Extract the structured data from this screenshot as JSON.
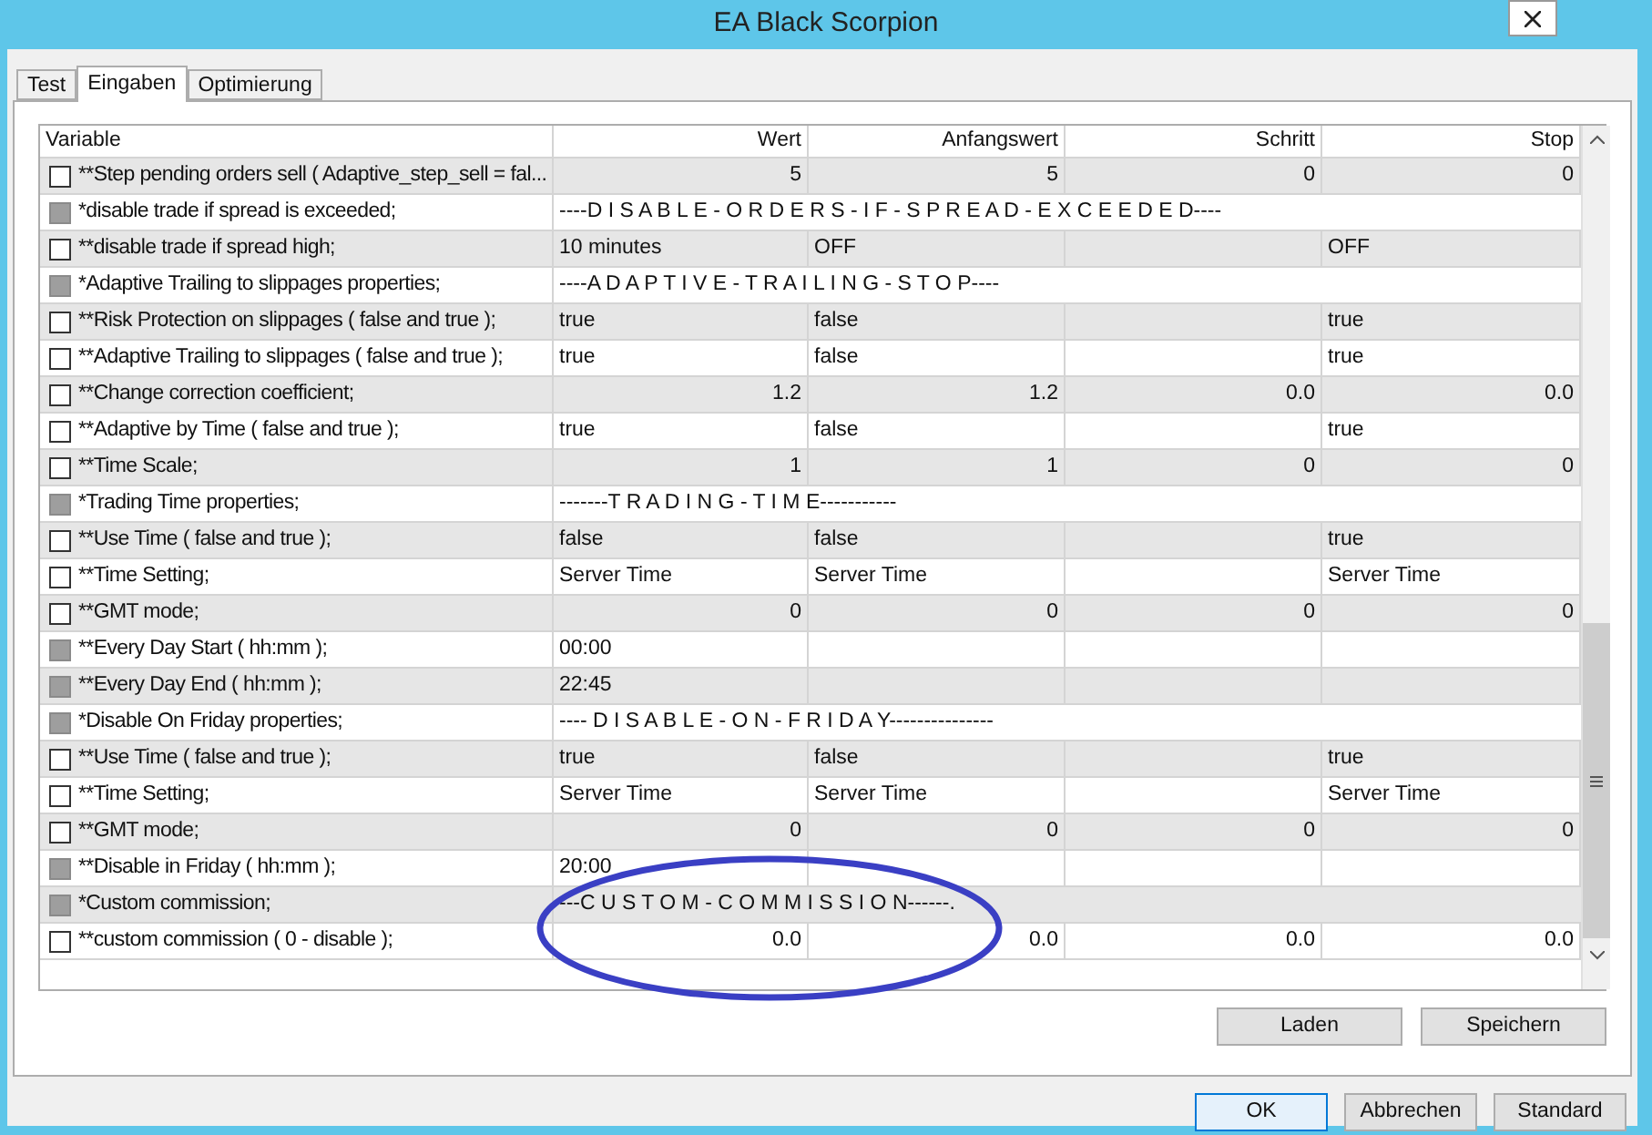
{
  "window": {
    "title": "EA Black Scorpion"
  },
  "tabs": [
    {
      "label": "Test",
      "selected": false
    },
    {
      "label": "Eingaben",
      "selected": true
    },
    {
      "label": "Optimierung",
      "selected": false
    }
  ],
  "table": {
    "columns": [
      "Variable",
      "Wert",
      "Anfangswert",
      "Schritt",
      "Stop"
    ],
    "rows": [
      {
        "kind": "param",
        "label": "**Step pending orders sell ( Adaptive_step_sell = fal...",
        "disabled": false,
        "value": "5",
        "start": "5",
        "step": "0",
        "stop": "0",
        "numeric": true
      },
      {
        "kind": "section",
        "label": "*disable trade if spread is exceeded;",
        "disabled": true,
        "value": "----D I S A B L E - O R D E R S - I F - S P R E A D - E X C E E D E D----"
      },
      {
        "kind": "param",
        "label": "**disable trade if spread high;",
        "disabled": false,
        "value": "10 minutes",
        "start": "OFF",
        "stop": "OFF",
        "numeric": false
      },
      {
        "kind": "section",
        "label": "*Adaptive Trailing to slippages properties;",
        "disabled": true,
        "value": "----A D A P T I V E - T R A I L I N G - S T O P----"
      },
      {
        "kind": "param",
        "label": "**Risk Protection on slippages ( false and true );",
        "disabled": false,
        "value": "true",
        "start": "false",
        "stop": "true",
        "numeric": false
      },
      {
        "kind": "param",
        "label": "**Adaptive Trailing to slippages ( false and true );",
        "disabled": false,
        "value": "true",
        "start": "false",
        "stop": "true",
        "numeric": false
      },
      {
        "kind": "param",
        "label": "**Change correction coefficient;",
        "disabled": false,
        "value": "1.2",
        "start": "1.2",
        "step": "0.0",
        "stop": "0.0",
        "numeric": true
      },
      {
        "kind": "param",
        "label": "**Adaptive by Time ( false and true );",
        "disabled": false,
        "value": "true",
        "start": "false",
        "stop": "true",
        "numeric": false
      },
      {
        "kind": "param",
        "label": "**Time Scale;",
        "disabled": false,
        "value": "1",
        "start": "1",
        "step": "0",
        "stop": "0",
        "numeric": true
      },
      {
        "kind": "section",
        "label": "*Trading Time properties;",
        "disabled": true,
        "value": "-------T R A D I N G - T I M E-----------"
      },
      {
        "kind": "param",
        "label": "**Use Time ( false and true );",
        "disabled": false,
        "value": "false",
        "start": "false",
        "stop": "true",
        "numeric": false
      },
      {
        "kind": "param",
        "label": "**Time Setting;",
        "disabled": false,
        "value": "Server Time",
        "start": "Server Time",
        "stop": "Server Time",
        "numeric": false
      },
      {
        "kind": "param",
        "label": "**GMT mode;",
        "disabled": false,
        "value": "0",
        "start": "0",
        "step": "0",
        "stop": "0",
        "numeric": true
      },
      {
        "kind": "param",
        "label": "**Every Day Start ( hh:mm );",
        "disabled": true,
        "value": "00:00",
        "numeric": false
      },
      {
        "kind": "param",
        "label": "**Every Day End ( hh:mm );",
        "disabled": true,
        "value": "22:45",
        "numeric": false
      },
      {
        "kind": "section",
        "label": "*Disable On Friday properties;",
        "disabled": true,
        "value": "---- D I S A B L E - O N - F R I D A Y---------------"
      },
      {
        "kind": "param",
        "label": "**Use Time ( false and true );",
        "disabled": false,
        "value": "true",
        "start": "false",
        "stop": "true",
        "numeric": false
      },
      {
        "kind": "param",
        "label": "**Time Setting;",
        "disabled": false,
        "value": "Server Time",
        "start": "Server Time",
        "stop": "Server Time",
        "numeric": false
      },
      {
        "kind": "param",
        "label": "**GMT mode;",
        "disabled": false,
        "value": "0",
        "start": "0",
        "step": "0",
        "stop": "0",
        "numeric": true
      },
      {
        "kind": "param",
        "label": "**Disable in Friday ( hh:mm );",
        "disabled": true,
        "value": "20:00",
        "numeric": false
      },
      {
        "kind": "section",
        "label": "*Custom commission;",
        "disabled": true,
        "value": "---C U S T O M - C O M M I S S I O N------."
      },
      {
        "kind": "param",
        "label": "**custom commission ( 0 - disable );",
        "disabled": false,
        "value": "0.0",
        "start": "0.0",
        "step": "0.0",
        "stop": "0.0",
        "numeric": true
      }
    ]
  },
  "panel_buttons": [
    "Laden",
    "Speichern"
  ],
  "dialog_buttons": [
    {
      "label": "OK",
      "selected": true
    },
    {
      "label": "Abbrechen",
      "selected": false
    },
    {
      "label": "Standard",
      "selected": false
    }
  ]
}
